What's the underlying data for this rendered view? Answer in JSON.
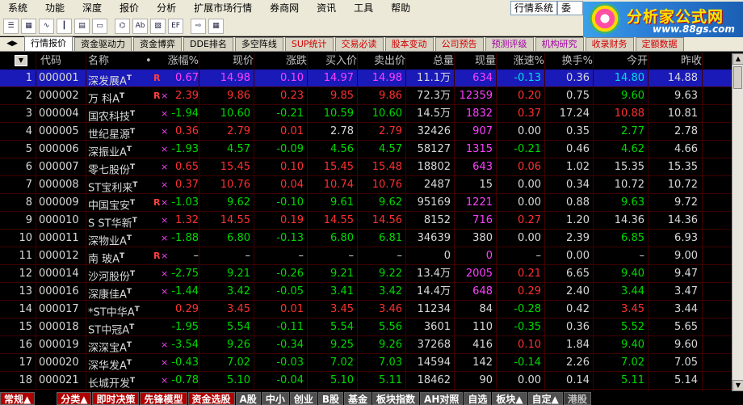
{
  "menu": [
    "系统",
    "功能",
    "深度",
    "报价",
    "分析",
    "扩展市场行情",
    "券商网",
    "资讯",
    "工具",
    "帮助"
  ],
  "top_buttons": {
    "quotes": "行情系统",
    "trade": "委托"
  },
  "logo": {
    "title": "分析家公式网",
    "url": "www.88gs.com"
  },
  "toolbar_icons": [
    "list-icon",
    "grid-icon",
    "trend-icon",
    "candlestick-icon",
    "multi-chart-icon",
    "window-icon",
    "tree-icon",
    "abc-icon",
    "news-icon",
    "ef-icon",
    "export-icon",
    "table-icon"
  ],
  "toolbar_labels": {
    "ef": "EF"
  },
  "tabs": [
    {
      "label": "行情报价",
      "style": "active"
    },
    {
      "label": "资金驱动力",
      "style": ""
    },
    {
      "label": "资金博弈",
      "style": ""
    },
    {
      "label": "DDE排名",
      "style": ""
    },
    {
      "label": "多空阵线",
      "style": ""
    },
    {
      "label": "SUP统计",
      "style": "red"
    },
    {
      "label": "交易必读",
      "style": "red"
    },
    {
      "label": "股本变动",
      "style": "red"
    },
    {
      "label": "公司预告",
      "style": "red"
    },
    {
      "label": "预测评级",
      "style": "purple"
    },
    {
      "label": "机构研究",
      "style": "purple"
    },
    {
      "label": "收录财务",
      "style": "red"
    },
    {
      "label": "定额数据",
      "style": "red"
    }
  ],
  "columns": [
    "",
    "代码",
    "名称",
    "•",
    "涨幅%",
    "现价",
    "涨跌",
    "买入价",
    "卖出价",
    "总量",
    "现量",
    "涨速%",
    "换手%",
    "今开",
    "昨收"
  ],
  "rows": [
    {
      "n": "1",
      "code": "000001",
      "name": "深发展A",
      "sup": "T",
      "flag": "R",
      "flag2": "",
      "pct": "0.67",
      "price": "14.98",
      "chg": "0.10",
      "bid": "14.97",
      "ask": "14.98",
      "vol": "11.1万",
      "cur": "634",
      "spd": "-0.13",
      "turn": "0.36",
      "open": "14.80",
      "prev": "14.88",
      "c": {
        "pct": "m",
        "price": "m",
        "chg": "m",
        "bid": "m",
        "ask": "m",
        "cur": "m",
        "spd": "cy",
        "open": "cy"
      },
      "hl": true
    },
    {
      "n": "2",
      "code": "000002",
      "name": "万  科A",
      "sup": "T",
      "flag": "R",
      "flag2": "×",
      "pct": "2.39",
      "price": "9.86",
      "chg": "0.23",
      "bid": "9.85",
      "ask": "9.86",
      "vol": "72.3万",
      "cur": "12359",
      "spd": "0.20",
      "turn": "0.75",
      "open": "9.60",
      "prev": "9.63",
      "c": {
        "pct": "r",
        "price": "r",
        "chg": "r",
        "bid": "r",
        "ask": "r",
        "cur": "m",
        "spd": "r",
        "open": "g"
      }
    },
    {
      "n": "3",
      "code": "000004",
      "name": "国农科技",
      "sup": "T",
      "flag": "",
      "flag2": "×",
      "pct": "-1.94",
      "price": "10.60",
      "chg": "-0.21",
      "bid": "10.59",
      "ask": "10.60",
      "vol": "14.5万",
      "cur": "1832",
      "spd": "0.37",
      "turn": "17.24",
      "open": "10.88",
      "prev": "10.81",
      "c": {
        "pct": "g",
        "price": "g",
        "chg": "g",
        "bid": "g",
        "ask": "g",
        "cur": "m",
        "spd": "r",
        "open": "r"
      }
    },
    {
      "n": "4",
      "code": "000005",
      "name": "世纪星源",
      "sup": "T",
      "flag": "",
      "flag2": "×",
      "pct": "0.36",
      "price": "2.79",
      "chg": "0.01",
      "bid": "2.78",
      "ask": "2.79",
      "vol": "32426",
      "cur": "907",
      "spd": "0.00",
      "turn": "0.35",
      "open": "2.77",
      "prev": "2.78",
      "c": {
        "pct": "r",
        "price": "r",
        "chg": "r",
        "bid": "w",
        "ask": "r",
        "cur": "m",
        "spd": "w",
        "open": "g"
      }
    },
    {
      "n": "5",
      "code": "000006",
      "name": "深振业A",
      "sup": "T",
      "flag": "",
      "flag2": "×",
      "pct": "-1.93",
      "price": "4.57",
      "chg": "-0.09",
      "bid": "4.56",
      "ask": "4.57",
      "vol": "58127",
      "cur": "1315",
      "spd": "-0.21",
      "turn": "0.46",
      "open": "4.62",
      "prev": "4.66",
      "c": {
        "pct": "g",
        "price": "g",
        "chg": "g",
        "bid": "g",
        "ask": "g",
        "cur": "m",
        "spd": "g",
        "open": "g"
      }
    },
    {
      "n": "6",
      "code": "000007",
      "name": "零七股份",
      "sup": "T",
      "flag": "",
      "flag2": "×",
      "pct": "0.65",
      "price": "15.45",
      "chg": "0.10",
      "bid": "15.45",
      "ask": "15.48",
      "vol": "18802",
      "cur": "643",
      "spd": "0.06",
      "turn": "1.02",
      "open": "15.35",
      "prev": "15.35",
      "c": {
        "pct": "r",
        "price": "r",
        "chg": "r",
        "bid": "r",
        "ask": "r",
        "cur": "m",
        "spd": "r",
        "open": "w"
      }
    },
    {
      "n": "7",
      "code": "000008",
      "name": "ST宝利来",
      "sup": "T",
      "flag": "",
      "flag2": "×",
      "pct": "0.37",
      "price": "10.76",
      "chg": "0.04",
      "bid": "10.74",
      "ask": "10.76",
      "vol": "2487",
      "cur": "15",
      "spd": "0.00",
      "turn": "0.34",
      "open": "10.72",
      "prev": "10.72",
      "c": {
        "pct": "r",
        "price": "r",
        "chg": "r",
        "bid": "r",
        "ask": "r",
        "cur": "w",
        "spd": "w",
        "open": "w"
      }
    },
    {
      "n": "8",
      "code": "000009",
      "name": "中国宝安",
      "sup": "T",
      "flag": "R",
      "flag2": "×",
      "pct": "-1.03",
      "price": "9.62",
      "chg": "-0.10",
      "bid": "9.61",
      "ask": "9.62",
      "vol": "95169",
      "cur": "1221",
      "spd": "0.00",
      "turn": "0.88",
      "open": "9.63",
      "prev": "9.72",
      "c": {
        "pct": "g",
        "price": "g",
        "chg": "g",
        "bid": "g",
        "ask": "g",
        "cur": "m",
        "spd": "w",
        "open": "g"
      }
    },
    {
      "n": "9",
      "code": "000010",
      "name": "S ST华新",
      "sup": "T",
      "flag": "",
      "flag2": "×",
      "pct": "1.32",
      "price": "14.55",
      "chg": "0.19",
      "bid": "14.55",
      "ask": "14.56",
      "vol": "8152",
      "cur": "716",
      "spd": "0.27",
      "turn": "1.20",
      "open": "14.36",
      "prev": "14.36",
      "c": {
        "pct": "r",
        "price": "r",
        "chg": "r",
        "bid": "r",
        "ask": "r",
        "cur": "m",
        "spd": "r",
        "open": "w"
      }
    },
    {
      "n": "10",
      "code": "000011",
      "name": "深物业A",
      "sup": "T",
      "flag": "",
      "flag2": "×",
      "pct": "-1.88",
      "price": "6.80",
      "chg": "-0.13",
      "bid": "6.80",
      "ask": "6.81",
      "vol": "34639",
      "cur": "380",
      "spd": "0.00",
      "turn": "2.39",
      "open": "6.85",
      "prev": "6.93",
      "c": {
        "pct": "g",
        "price": "g",
        "chg": "g",
        "bid": "g",
        "ask": "g",
        "cur": "w",
        "spd": "w",
        "open": "g"
      }
    },
    {
      "n": "11",
      "code": "000012",
      "name": "南  玻A",
      "sup": "T",
      "flag": "R",
      "flag2": "×",
      "pct": "–",
      "price": "–",
      "chg": "–",
      "bid": "–",
      "ask": "–",
      "vol": "0",
      "cur": "0",
      "spd": "–",
      "turn": "0.00",
      "open": "–",
      "prev": "9.00",
      "c": {
        "pct": "w",
        "price": "w",
        "chg": "w",
        "bid": "w",
        "ask": "w",
        "cur": "m",
        "spd": "w",
        "open": "w"
      }
    },
    {
      "n": "12",
      "code": "000014",
      "name": "沙河股份",
      "sup": "T",
      "flag": "",
      "flag2": "×",
      "pct": "-2.75",
      "price": "9.21",
      "chg": "-0.26",
      "bid": "9.21",
      "ask": "9.22",
      "vol": "13.4万",
      "cur": "2005",
      "spd": "0.21",
      "turn": "6.65",
      "open": "9.40",
      "prev": "9.47",
      "c": {
        "pct": "g",
        "price": "g",
        "chg": "g",
        "bid": "g",
        "ask": "g",
        "cur": "m",
        "spd": "r",
        "open": "g"
      }
    },
    {
      "n": "13",
      "code": "000016",
      "name": "深康佳A",
      "sup": "T",
      "flag": "",
      "flag2": "×",
      "pct": "-1.44",
      "price": "3.42",
      "chg": "-0.05",
      "bid": "3.41",
      "ask": "3.42",
      "vol": "14.4万",
      "cur": "648",
      "spd": "0.29",
      "turn": "2.40",
      "open": "3.44",
      "prev": "3.47",
      "c": {
        "pct": "g",
        "price": "g",
        "chg": "g",
        "bid": "g",
        "ask": "g",
        "cur": "m",
        "spd": "r",
        "open": "g"
      }
    },
    {
      "n": "14",
      "code": "000017",
      "name": "*ST中华A",
      "sup": "T",
      "flag": "",
      "flag2": "",
      "pct": "0.29",
      "price": "3.45",
      "chg": "0.01",
      "bid": "3.45",
      "ask": "3.46",
      "vol": "11234",
      "cur": "84",
      "spd": "-0.28",
      "turn": "0.42",
      "open": "3.45",
      "prev": "3.44",
      "c": {
        "pct": "r",
        "price": "r",
        "chg": "r",
        "bid": "r",
        "ask": "r",
        "cur": "w",
        "spd": "g",
        "open": "r"
      }
    },
    {
      "n": "15",
      "code": "000018",
      "name": "ST中冠A",
      "sup": "T",
      "flag": "",
      "flag2": "",
      "pct": "-1.95",
      "price": "5.54",
      "chg": "-0.11",
      "bid": "5.54",
      "ask": "5.56",
      "vol": "3601",
      "cur": "110",
      "spd": "-0.35",
      "turn": "0.36",
      "open": "5.52",
      "prev": "5.65",
      "c": {
        "pct": "g",
        "price": "g",
        "chg": "g",
        "bid": "g",
        "ask": "g",
        "cur": "w",
        "spd": "g",
        "open": "g"
      }
    },
    {
      "n": "16",
      "code": "000019",
      "name": "深深宝A",
      "sup": "T",
      "flag": "",
      "flag2": "×",
      "pct": "-3.54",
      "price": "9.26",
      "chg": "-0.34",
      "bid": "9.25",
      "ask": "9.26",
      "vol": "37268",
      "cur": "416",
      "spd": "0.10",
      "turn": "1.84",
      "open": "9.40",
      "prev": "9.60",
      "c": {
        "pct": "g",
        "price": "g",
        "chg": "g",
        "bid": "g",
        "ask": "g",
        "cur": "w",
        "spd": "r",
        "open": "g"
      }
    },
    {
      "n": "17",
      "code": "000020",
      "name": "深华发A",
      "sup": "T",
      "flag": "",
      "flag2": "×",
      "pct": "-0.43",
      "price": "7.02",
      "chg": "-0.03",
      "bid": "7.02",
      "ask": "7.03",
      "vol": "14594",
      "cur": "142",
      "spd": "-0.14",
      "turn": "2.26",
      "open": "7.02",
      "prev": "7.05",
      "c": {
        "pct": "g",
        "price": "g",
        "chg": "g",
        "bid": "g",
        "ask": "g",
        "cur": "w",
        "spd": "g",
        "open": "g"
      }
    },
    {
      "n": "18",
      "code": "000021",
      "name": "长城开发",
      "sup": "T",
      "flag": "",
      "flag2": "×",
      "pct": "-0.78",
      "price": "5.10",
      "chg": "-0.04",
      "bid": "5.10",
      "ask": "5.11",
      "vol": "18462",
      "cur": "90",
      "spd": "0.00",
      "turn": "0.14",
      "open": "5.11",
      "prev": "5.14",
      "c": {
        "pct": "g",
        "price": "g",
        "chg": "g",
        "bid": "g",
        "ask": "g",
        "cur": "w",
        "spd": "w",
        "open": "g"
      }
    }
  ],
  "bottom_tabs": [
    {
      "label": "常规▲",
      "style": "red"
    },
    {
      "label": "分类▲",
      "style": "red"
    },
    {
      "label": "即时决策",
      "style": "red"
    },
    {
      "label": "先锋模型",
      "style": "red"
    },
    {
      "label": "资金选股",
      "style": "red"
    },
    {
      "label": "A股",
      "style": "grey"
    },
    {
      "label": "中小",
      "style": "grey"
    },
    {
      "label": "创业",
      "style": "grey"
    },
    {
      "label": "B股",
      "style": "grey"
    },
    {
      "label": "基金",
      "style": "grey"
    },
    {
      "label": "板块指数",
      "style": "grey"
    },
    {
      "label": "AH对照",
      "style": "grey"
    },
    {
      "label": "自选",
      "style": "grey"
    },
    {
      "label": "板块▲",
      "style": "grey"
    },
    {
      "label": "自定▲",
      "style": "grey"
    },
    {
      "label": "港股",
      "style": "dim"
    }
  ],
  "colors": {
    "up": "#ff3030",
    "down": "#00d800",
    "volume": "#ff40ff",
    "highlight": "#1a1ab8",
    "grid": "#400000"
  }
}
